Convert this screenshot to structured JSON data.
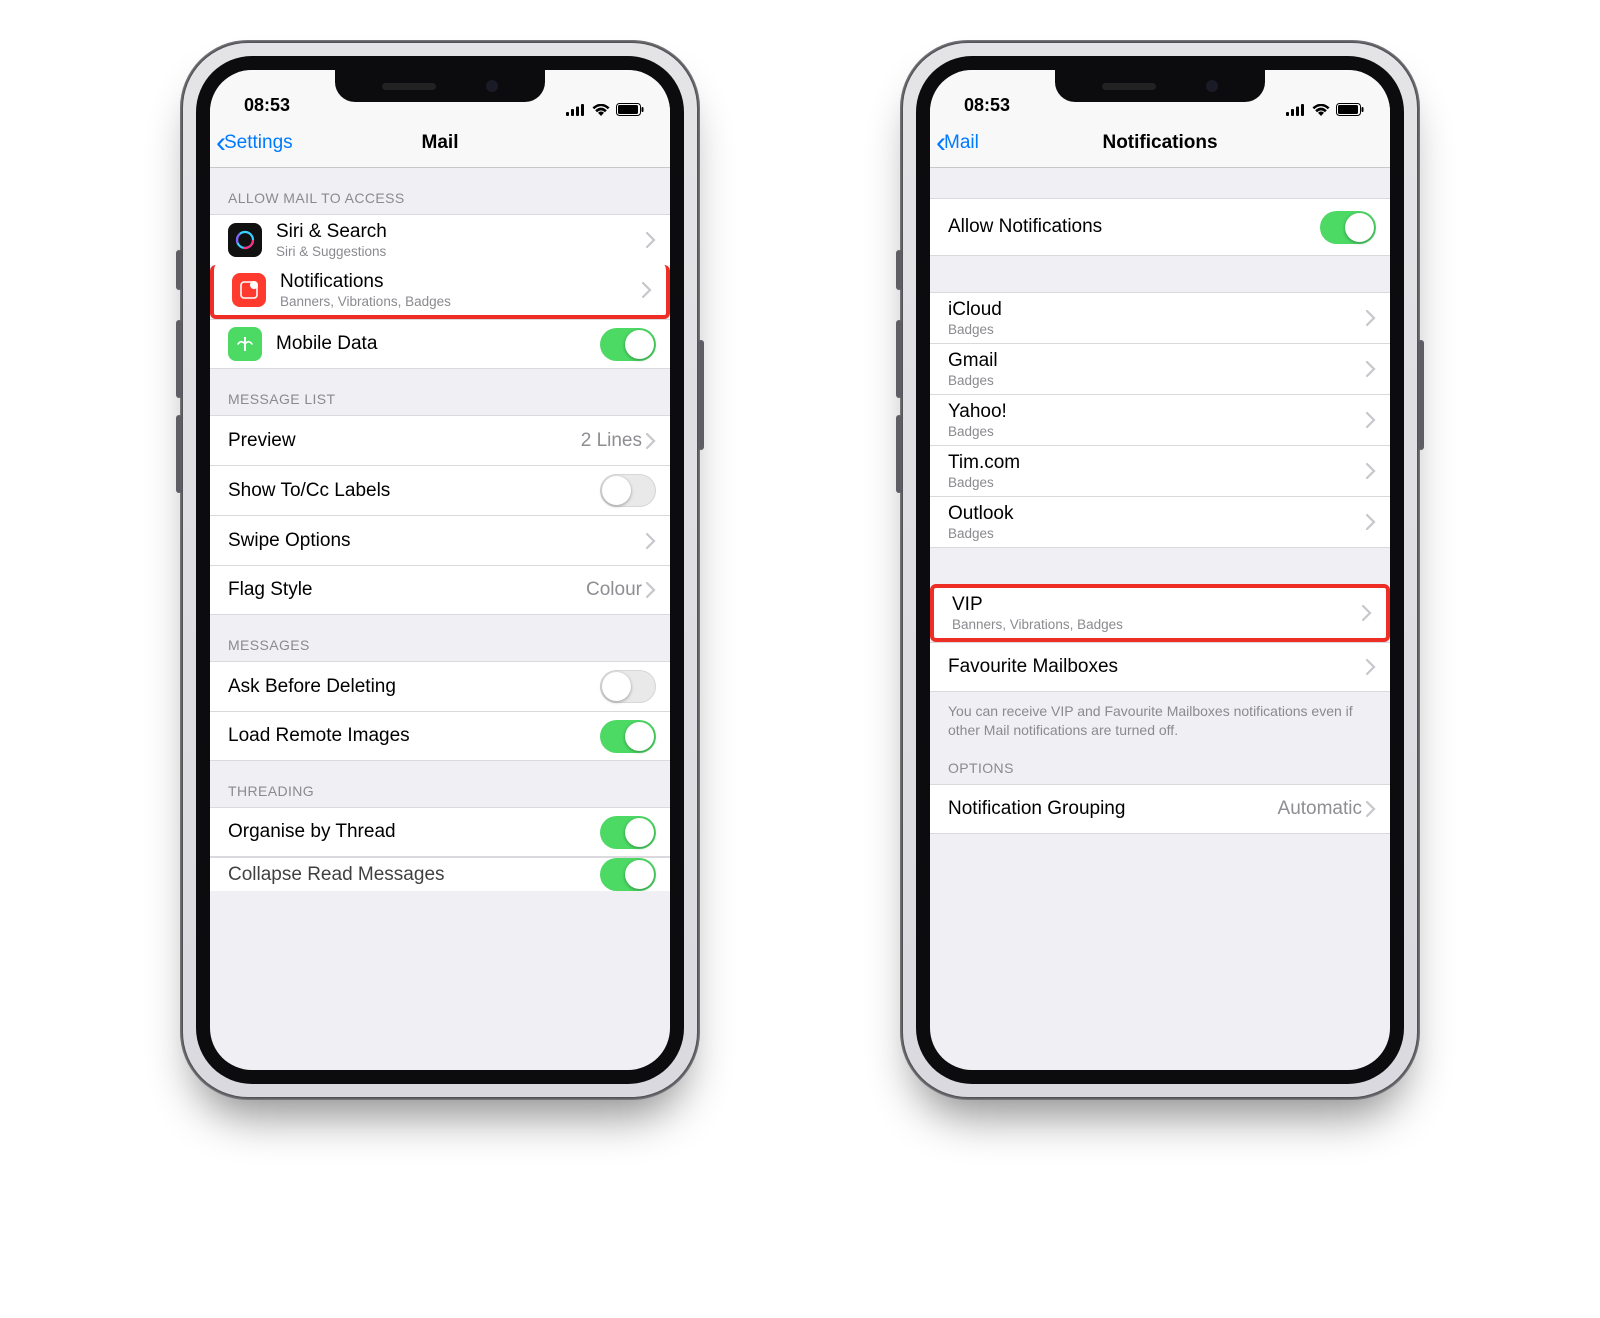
{
  "status_time": "08:53",
  "phone1": {
    "back_label": "Settings",
    "title": "Mail",
    "section_access": "Allow Mail to Access",
    "row_siri_title": "Siri & Search",
    "row_siri_sub": "Siri & Suggestions",
    "row_notif_title": "Notifications",
    "row_notif_sub": "Banners, Vibrations, Badges",
    "row_mobile_title": "Mobile Data",
    "section_msglist": "Message List",
    "row_preview_title": "Preview",
    "row_preview_value": "2 Lines",
    "row_tocc_title": "Show To/Cc Labels",
    "row_swipe_title": "Swipe Options",
    "row_flag_title": "Flag Style",
    "row_flag_value": "Colour",
    "section_messages": "Messages",
    "row_askdel_title": "Ask Before Deleting",
    "row_remote_title": "Load Remote Images",
    "section_threading": "Threading",
    "row_org_title": "Organise by Thread",
    "row_collapse_title": "Collapse Read Messages"
  },
  "phone2": {
    "back_label": "Mail",
    "title": "Notifications",
    "row_allow_title": "Allow Notifications",
    "accounts": [
      {
        "name": "iCloud",
        "sub": "Badges"
      },
      {
        "name": "Gmail",
        "sub": "Badges"
      },
      {
        "name": "Yahoo!",
        "sub": "Badges"
      },
      {
        "name": "Tim.com",
        "sub": "Badges"
      },
      {
        "name": "Outlook",
        "sub": "Badges"
      }
    ],
    "row_vip_title": "VIP",
    "row_vip_sub": "Banners, Vibrations, Badges",
    "row_fav_title": "Favourite Mailboxes",
    "footer": "You can receive VIP and Favourite Mailboxes notifications even if other Mail notifications are turned off.",
    "section_options": "Options",
    "row_group_title": "Notification Grouping",
    "row_group_value": "Automatic"
  }
}
